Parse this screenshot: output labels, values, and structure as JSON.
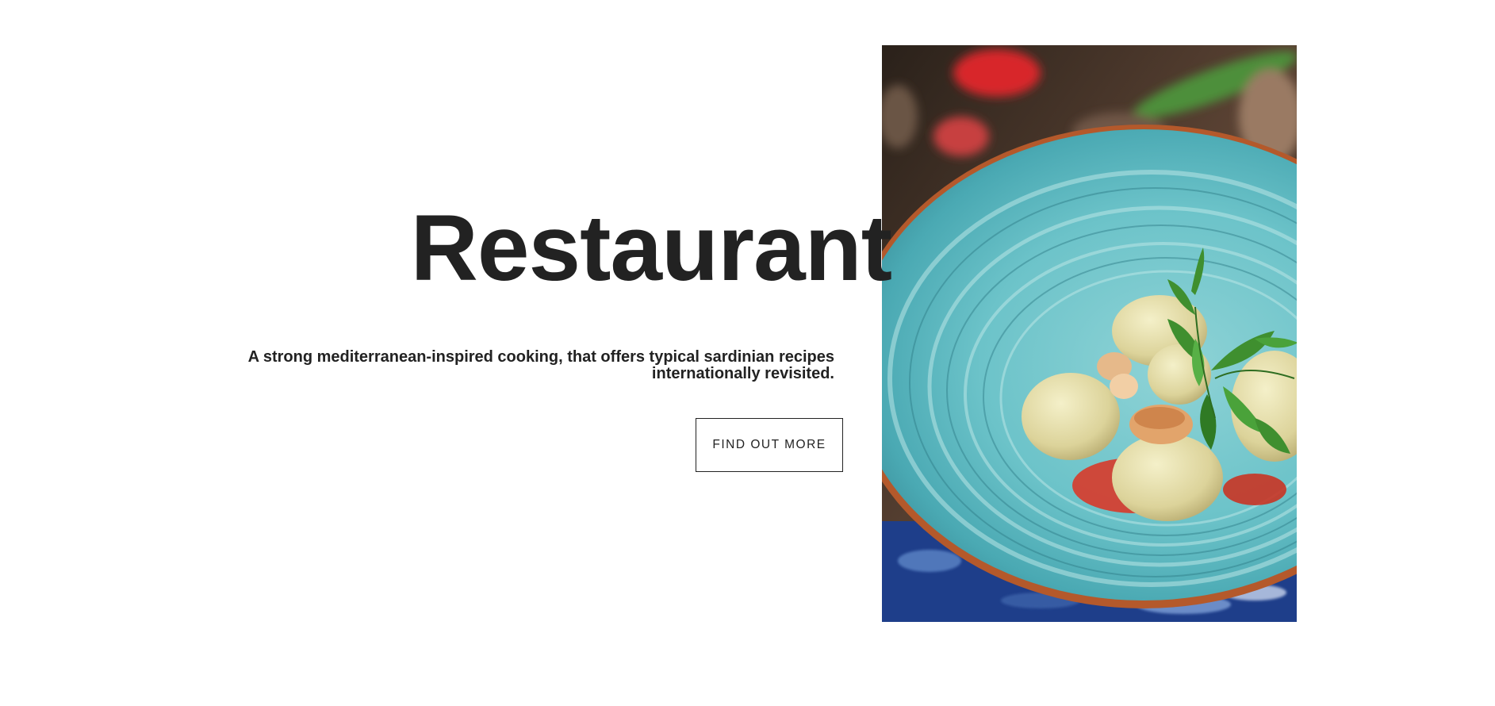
{
  "hero": {
    "title": "Restaurant",
    "subtitle": "A strong mediterranean-inspired cooking, that offers typical sardinian recipes internationally revisited.",
    "cta_label": "FIND OUT MORE"
  },
  "image": {
    "subject": "food-photo-dumplings-in-turquoise-plate"
  },
  "colors": {
    "text": "#222222",
    "background": "#ffffff",
    "plate": "#6cc3c9"
  }
}
